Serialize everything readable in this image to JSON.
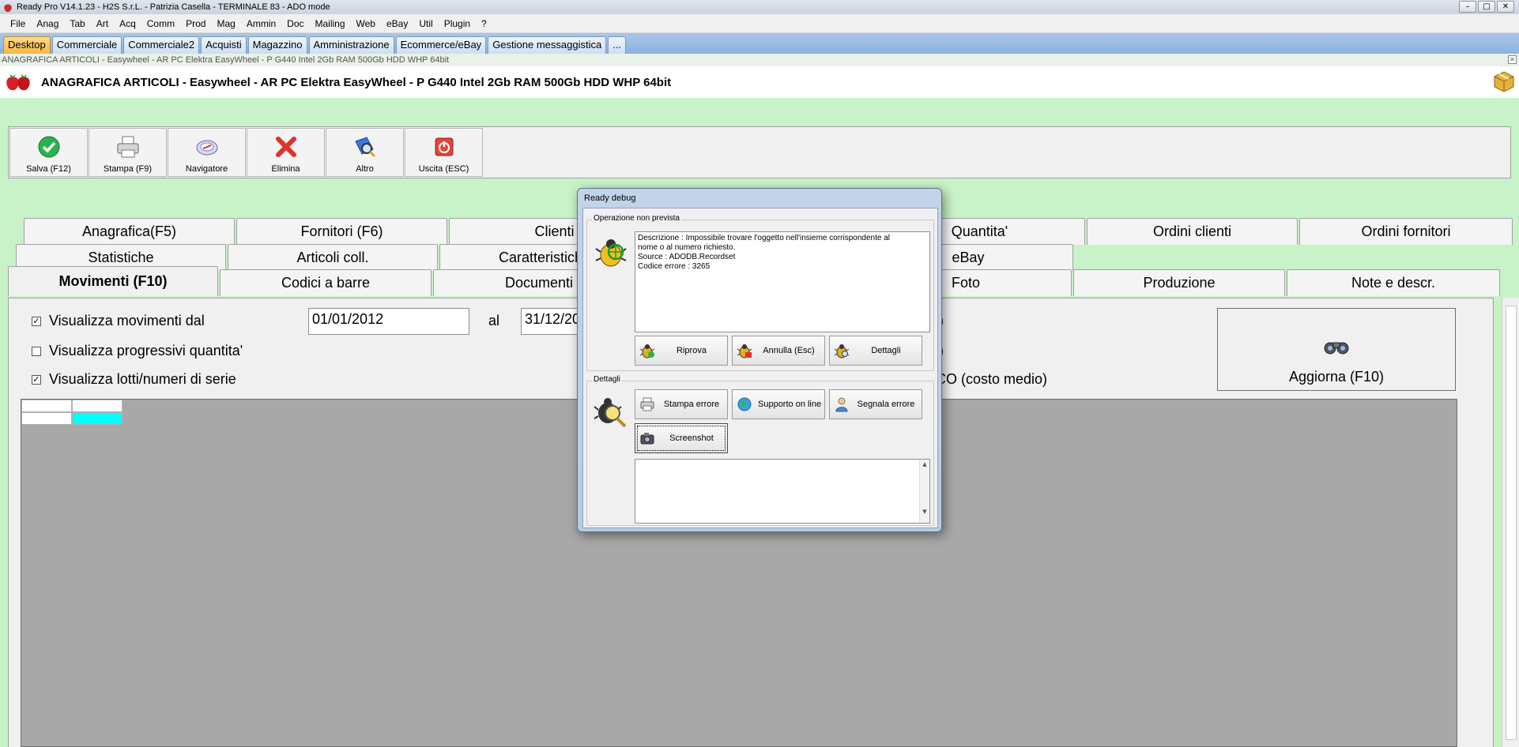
{
  "window": {
    "title": "Ready Pro V14.1.23 - H2S S.r.L. - Patrizia Casella - TERMINALE 83 - ADO mode",
    "controls": [
      "–",
      "□",
      "✕"
    ]
  },
  "menu": [
    "File",
    "Anag",
    "Tab",
    "Art",
    "Acq",
    "Comm",
    "Prod",
    "Mag",
    "Ammin",
    "Doc",
    "Mailing",
    "Web",
    "eBay",
    "Util",
    "Plugin",
    "?"
  ],
  "desktop_tabs": [
    {
      "label": "Desktop",
      "active": true
    },
    {
      "label": "Commerciale",
      "active": false
    },
    {
      "label": "Commerciale2",
      "active": false
    },
    {
      "label": "Acquisti",
      "active": false
    },
    {
      "label": "Magazzino",
      "active": false
    },
    {
      "label": "Amministrazione",
      "active": false
    },
    {
      "label": "Ecommerce/eBay",
      "active": false
    },
    {
      "label": "Gestione messaggistica",
      "active": false
    },
    {
      "label": "...",
      "active": false
    }
  ],
  "doc_path": "ANAGRAFICA ARTICOLI - Easywheel - AR PC Elektra EasyWheel - P G440 Intel 2Gb RAM 500Gb HDD WHP 64bit",
  "header_title": "ANAGRAFICA ARTICOLI - Easywheel - AR PC Elektra EasyWheel - P G440 Intel 2Gb RAM 500Gb HDD WHP 64bit",
  "toolbar": {
    "save": "Salva (F12)",
    "print": "Stampa (F9)",
    "navigator": "Navigatore",
    "delete": "Elimina",
    "other": "Altro",
    "exit": "Uscita (ESC)"
  },
  "tabs": {
    "row1": [
      "Anagrafica(F5)",
      "Fornitori (F6)",
      "Clienti",
      "",
      "Quantita'",
      "Ordini clienti",
      "Ordini fornitori"
    ],
    "row2": [
      "Statistiche",
      "Articoli coll.",
      "Caratteristiche",
      "",
      "eBay"
    ],
    "row3": [
      "Movimenti (F10)",
      "Codici a barre",
      "Documenti",
      "",
      "Foto",
      "Produzione",
      "Note e descr."
    ]
  },
  "movimenti": {
    "show_movements_label": "Visualizza movimenti dal",
    "show_movements_checked": true,
    "date_from": "01/01/2012",
    "al_label": "al",
    "date_to": "31/12/2012",
    "show_progressive_label": "Visualizza progressivi quantita'",
    "show_progressive_checked": false,
    "show_lots_label": "Visualizza lotti/numeri di serie",
    "show_lots_checked": true,
    "partial_right_1": ")",
    "partial_right_2": ")",
    "cost_label": "CO (costo medio)",
    "refresh_label": "Aggiorna (F10)"
  },
  "dialog": {
    "title": "Ready debug",
    "group_error": "Operazione non prevista",
    "error_lines": [
      "Descrizione : Impossibile trovare l'oggetto nell'insieme corrispondente al",
      "nome o al numero richiesto.",
      "Source : ADODB.Recordset",
      "Codice errore : 3265"
    ],
    "retry": "Riprova",
    "cancel": "Annulla (Esc)",
    "details": "Dettagli",
    "group_details": "Dettagli",
    "print_error": "Stampa errore",
    "online_support": "Supporto on line",
    "report_error": "Segnala errore",
    "screenshot": "Screenshot"
  },
  "colors": {
    "background": "#c8f2c8",
    "desktop_tab_active": "#f6b642",
    "grid_background": "#a8a8a8",
    "grid_selected_cell": "#00ffff"
  }
}
